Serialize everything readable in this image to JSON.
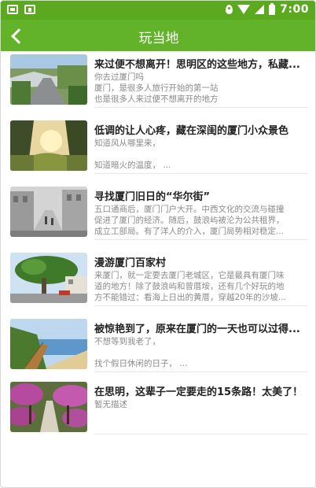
{
  "status_bar": {
    "time": "7:00"
  },
  "nav": {
    "title": "玩当地"
  },
  "articles": [
    {
      "title": "来过便不想离开！思明区的这些地方，私藏...",
      "lines": [
        "你去过厦门吗",
        "厦门，是很多人旅行开始的第一站",
        "也是很多人来过便不想离开的地方"
      ]
    },
    {
      "title": "低调的让人心疼，藏在深闺的厦门小众景色",
      "lines": [
        "知道风从哪里来，",
        "",
        "知道暗火的温度，  ..."
      ]
    },
    {
      "title": "寻找厦门旧日的“华尔街”",
      "lines": [
        "五口通商后，厦门门户大开。中西文化的交流与碰撞",
        "促进了厦门的经济。随后，鼓浪屿被沦为公共租界，",
        "成立工部局。有了洋人的介入，厦门局势相对稳定..."
      ]
    },
    {
      "title": "漫游厦门百家村",
      "lines": [
        "来厦门，就一定要去厦门老城区，它是最具有厦门味",
        "道的地方！除了鼓浪屿和曾厝垵，还有几个好玩的地",
        "方不能错过：看海上日出的黄厝，穿越20年的沙坡..."
      ]
    },
    {
      "title": "被惊艳到了，原来在厦门的一天也可以过得...",
      "lines": [
        "不想等到我老了，",
        "",
        "找个假日休闲的日子，  ..."
      ]
    },
    {
      "title": "在思明，这辈子一定要走的15条路！太美了！",
      "lines": [
        "暂无描述"
      ]
    }
  ]
}
